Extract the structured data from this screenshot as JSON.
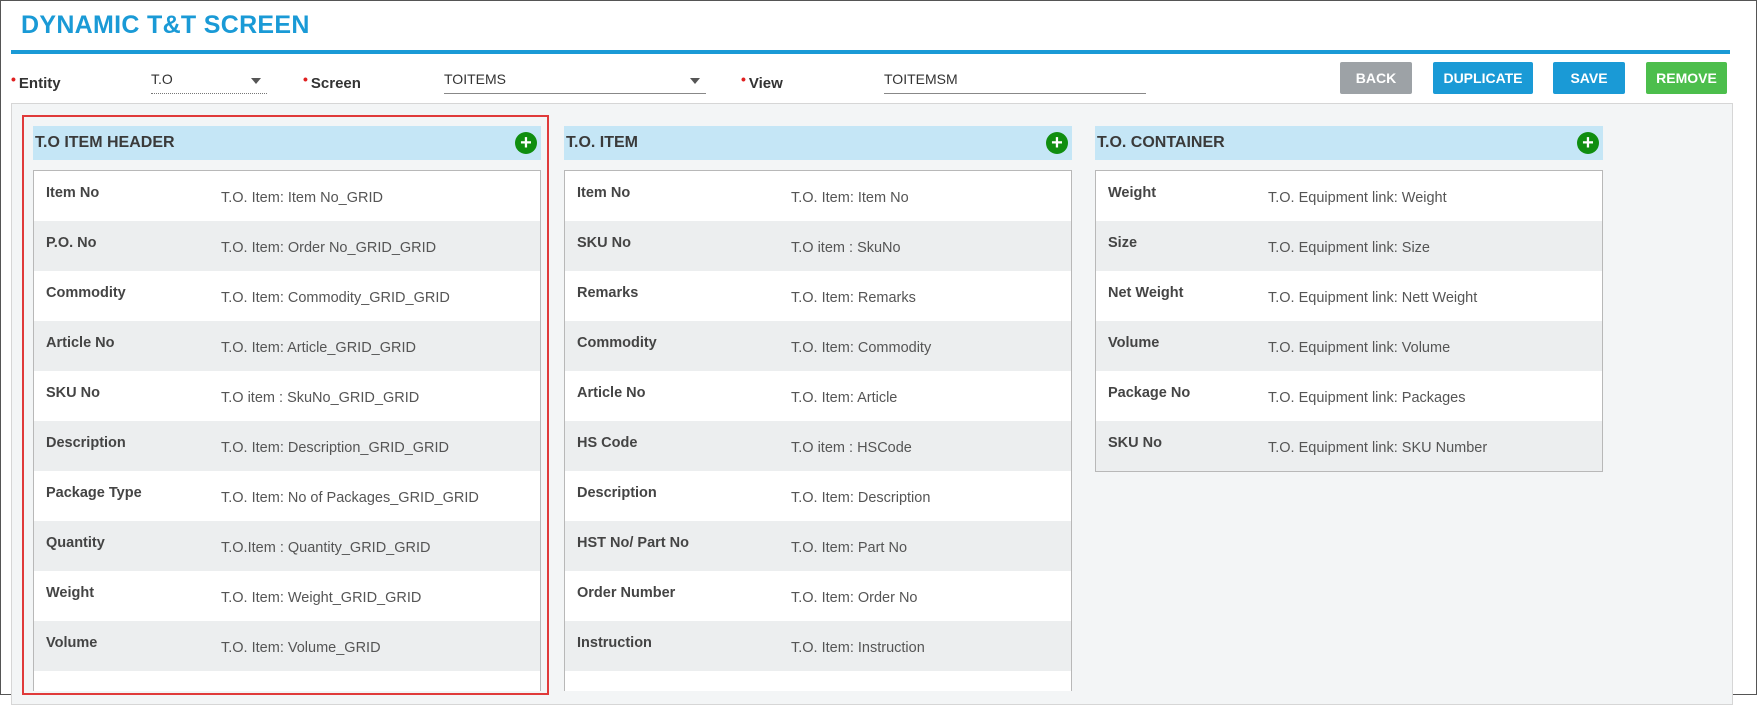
{
  "page": {
    "title": "DYNAMIC T&T SCREEN"
  },
  "filters": {
    "entity": {
      "label": "Entity",
      "value": "T.O"
    },
    "screen": {
      "label": "Screen",
      "value": "TOITEMS"
    },
    "view": {
      "label": "View",
      "value": "TOITEMSM"
    }
  },
  "buttons": {
    "back": "BACK",
    "duplicate": "DUPLICATE",
    "save": "SAVE",
    "remove": "REMOVE"
  },
  "panels": [
    {
      "title": "T.O ITEM HEADER",
      "rows": [
        {
          "label": "Item No",
          "value": "T.O. Item: Item No_GRID"
        },
        {
          "label": "P.O. No",
          "value": "T.O. Item: Order No_GRID_GRID"
        },
        {
          "label": "Commodity",
          "value": "T.O. Item: Commodity_GRID_GRID"
        },
        {
          "label": "Article No",
          "value": "T.O. Item: Article_GRID_GRID"
        },
        {
          "label": "SKU No",
          "value": "T.O item : SkuNo_GRID_GRID"
        },
        {
          "label": "Description",
          "value": "T.O. Item: Description_GRID_GRID"
        },
        {
          "label": "Package Type",
          "value": "T.O. Item: No of Packages_GRID_GRID"
        },
        {
          "label": "Quantity",
          "value": "T.O.Item : Quantity_GRID_GRID"
        },
        {
          "label": "Weight",
          "value": "T.O. Item: Weight_GRID_GRID"
        },
        {
          "label": "Volume",
          "value": "T.O. Item: Volume_GRID"
        }
      ]
    },
    {
      "title": "T.O. ITEM",
      "rows": [
        {
          "label": "Item No",
          "value": "T.O. Item: Item No"
        },
        {
          "label": "SKU No",
          "value": "T.O item : SkuNo"
        },
        {
          "label": "Remarks",
          "value": "T.O. Item: Remarks"
        },
        {
          "label": "Commodity",
          "value": "T.O. Item: Commodity"
        },
        {
          "label": "Article No",
          "value": "T.O. Item: Article"
        },
        {
          "label": "HS Code",
          "value": "T.O item : HSCode"
        },
        {
          "label": "Description",
          "value": "T.O. Item: Description"
        },
        {
          "label": "HST No/ Part No",
          "value": "T.O. Item: Part No"
        },
        {
          "label": "Order Number",
          "value": "T.O. Item: Order No"
        },
        {
          "label": "Instruction",
          "value": "T.O. Item: Instruction"
        }
      ]
    },
    {
      "title": "T.O. CONTAINER",
      "rows": [
        {
          "label": "Weight",
          "value": "T.O. Equipment link: Weight"
        },
        {
          "label": "Size",
          "value": "T.O. Equipment link: Size"
        },
        {
          "label": "Net Weight",
          "value": "T.O. Equipment link: Nett Weight"
        },
        {
          "label": "Volume",
          "value": "T.O. Equipment link: Volume"
        },
        {
          "label": "Package No",
          "value": "T.O. Equipment link: Packages"
        },
        {
          "label": "SKU No",
          "value": "T.O. Equipment link: SKU Number"
        }
      ]
    }
  ],
  "colors": {
    "accent": "#1a9ad6",
    "panel_header": "#c5e6f6",
    "add_icon": "#108e10",
    "remove_button": "#4cbe4c",
    "back_button": "#9da2a6",
    "highlight_border": "#e03a3a"
  }
}
